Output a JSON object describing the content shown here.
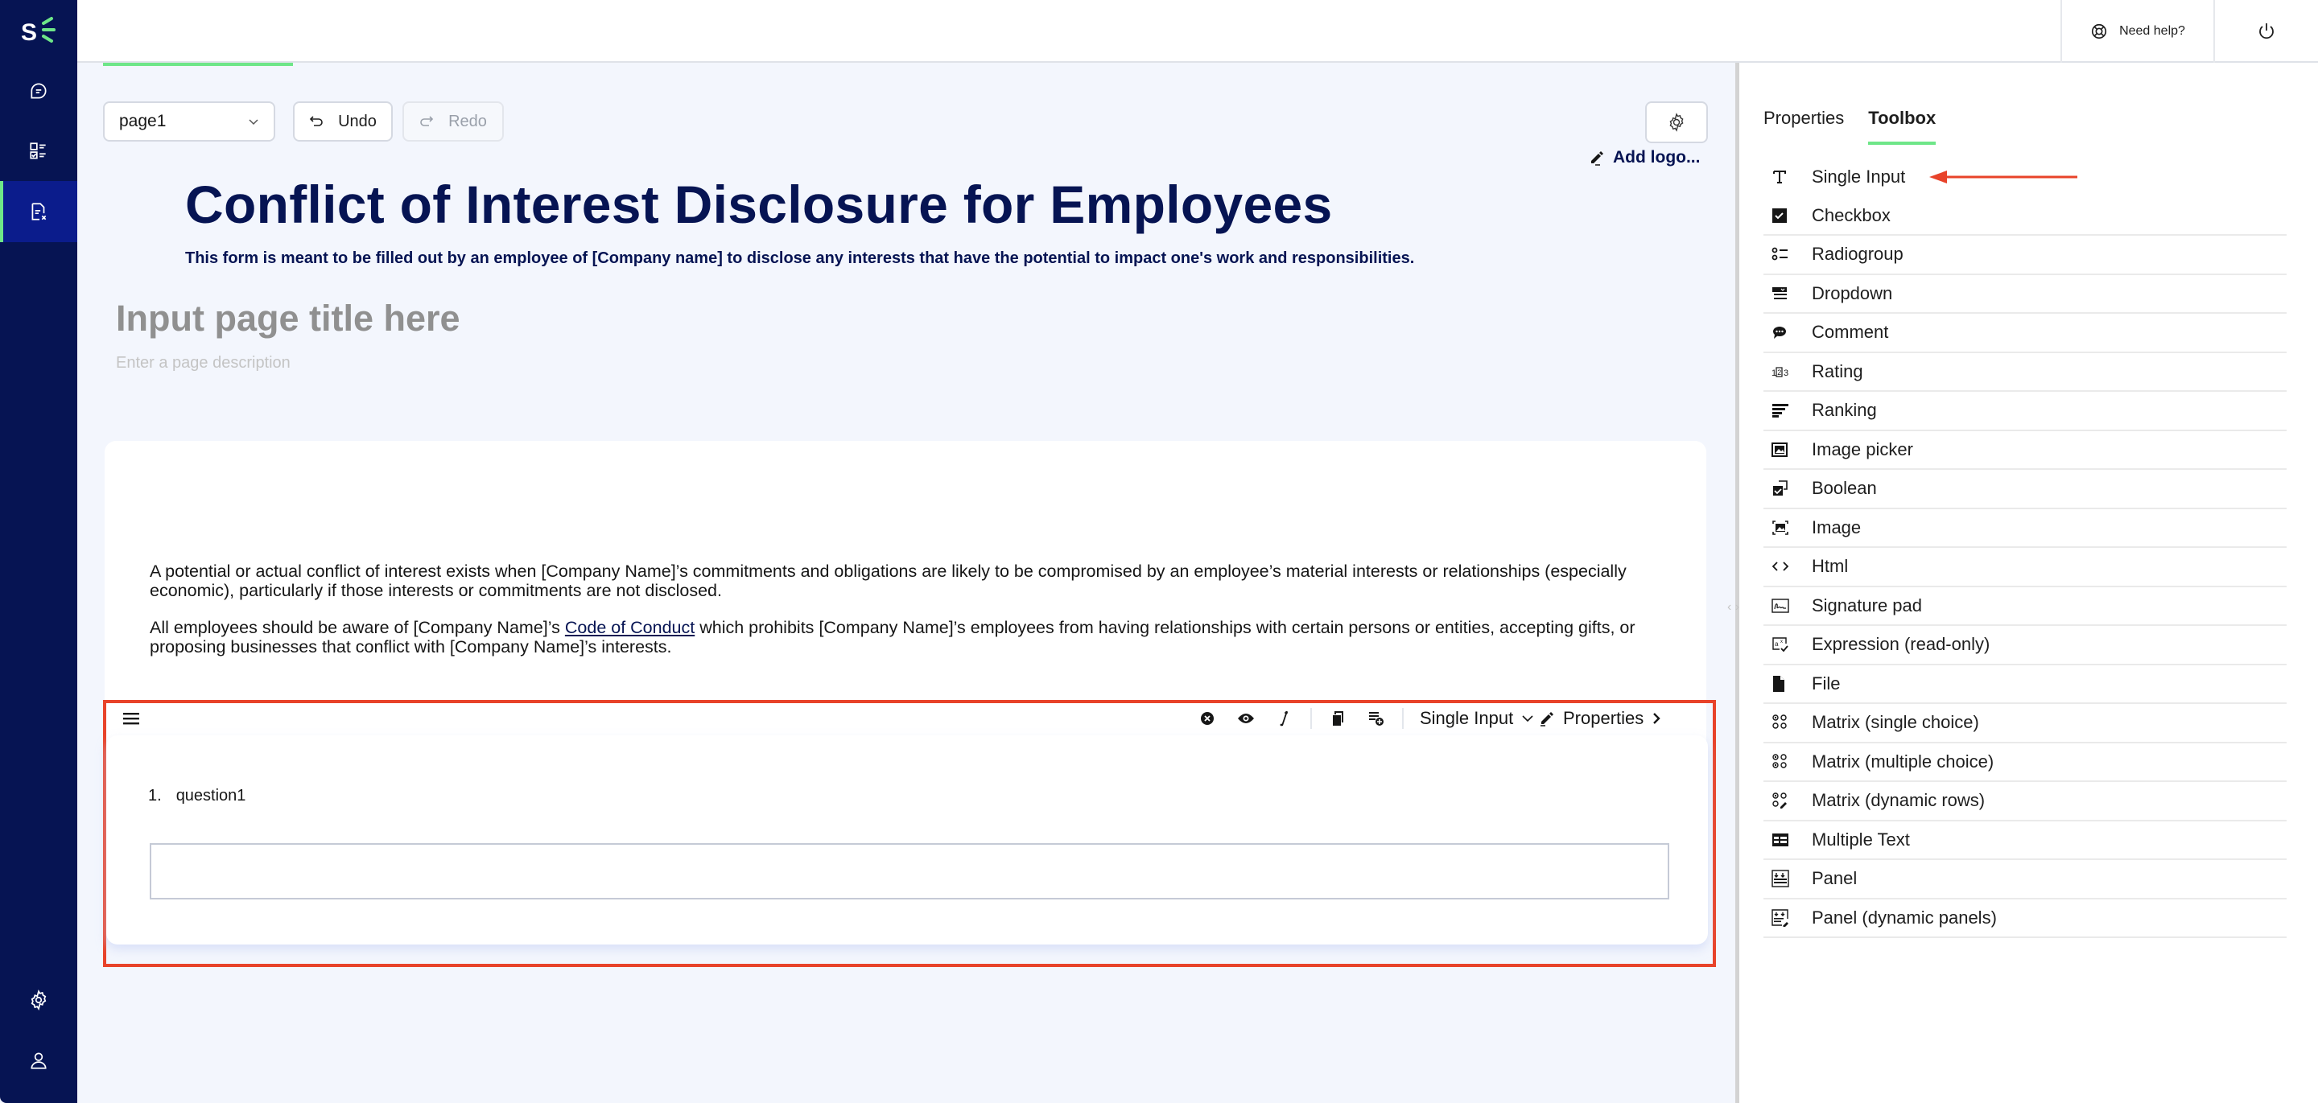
{
  "app": {
    "brand": "S",
    "left_nav": [
      {
        "name": "chat",
        "icon": "chat-bubble-icon",
        "active": false
      },
      {
        "name": "surveys",
        "icon": "checklist-icon",
        "active": false
      },
      {
        "name": "forms",
        "icon": "document-edit-icon",
        "active": true
      }
    ],
    "left_nav_bottom": [
      {
        "name": "settings",
        "icon": "gear-icon"
      },
      {
        "name": "profile",
        "icon": "user-icon"
      }
    ]
  },
  "header": {
    "help_label": "Need help?",
    "power_icon": "power-icon"
  },
  "designer": {
    "progress": 0.11,
    "page_select": {
      "value": "page1"
    },
    "undo_label": "Undo",
    "redo_label": "Redo",
    "add_logo_label": "Add logo...",
    "survey_title": "Conflict of Interest Disclosure for Employees",
    "survey_description": "This form is meant to be filled out by an employee of [Company name] to disclose any interests that have the potential to impact one's work and responsibilities.",
    "page_title_placeholder": "Input page title here",
    "page_description_placeholder": "Enter a page description",
    "html_block": {
      "p1": "A potential or actual conflict of interest exists when [Company Name]’s commitments and obligations are likely to be compromised by an employee’s material interests or relationships (especially economic), particularly if those interests or commitments are not disclosed.",
      "p2_before": "All employees should be aware of [Company Name]’s ",
      "p2_link": "Code of Conduct",
      "p2_after": " which prohibits [Company Name]’s employees from having relationships with certain persons or entities, accepting gifts, or proposing businesses that conflict with [Company Name]’s interests."
    },
    "question": {
      "number": "1.",
      "title": "question1",
      "type_label": "Single Input",
      "properties_label": "Properties",
      "input_value": ""
    }
  },
  "right_panel": {
    "tabs": [
      {
        "label": "Properties",
        "active": false
      },
      {
        "label": "Toolbox",
        "active": true
      }
    ],
    "toolbox": [
      {
        "label": "Single Input",
        "icon": "text-t-icon"
      },
      {
        "label": "Checkbox",
        "icon": "checkbox-icon"
      },
      {
        "label": "Radiogroup",
        "icon": "radiogroup-icon"
      },
      {
        "label": "Dropdown",
        "icon": "dropdown-icon"
      },
      {
        "label": "Comment",
        "icon": "comment-icon"
      },
      {
        "label": "Rating",
        "icon": "rating-icon"
      },
      {
        "label": "Ranking",
        "icon": "ranking-icon"
      },
      {
        "label": "Image picker",
        "icon": "image-picker-icon"
      },
      {
        "label": "Boolean",
        "icon": "boolean-icon"
      },
      {
        "label": "Image",
        "icon": "image-icon"
      },
      {
        "label": "Html",
        "icon": "html-code-icon"
      },
      {
        "label": "Signature pad",
        "icon": "signature-icon"
      },
      {
        "label": "Expression (read-only)",
        "icon": "expression-icon"
      },
      {
        "label": "File",
        "icon": "file-icon"
      },
      {
        "label": "Matrix (single choice)",
        "icon": "matrix-single-icon"
      },
      {
        "label": "Matrix (multiple choice)",
        "icon": "matrix-multiple-icon"
      },
      {
        "label": "Matrix (dynamic rows)",
        "icon": "matrix-dynamic-icon"
      },
      {
        "label": "Multiple Text",
        "icon": "multiple-text-icon"
      },
      {
        "label": "Panel",
        "icon": "panel-icon"
      },
      {
        "label": "Panel (dynamic panels)",
        "icon": "panel-dynamic-icon"
      }
    ]
  },
  "colors": {
    "nav_bg": "#061453",
    "nav_active": "#0b1c8c",
    "accent_green": "#6ee688",
    "title_navy": "#061453",
    "highlight_red": "#e8432a",
    "canvas_bg": "#f3f6fd"
  }
}
